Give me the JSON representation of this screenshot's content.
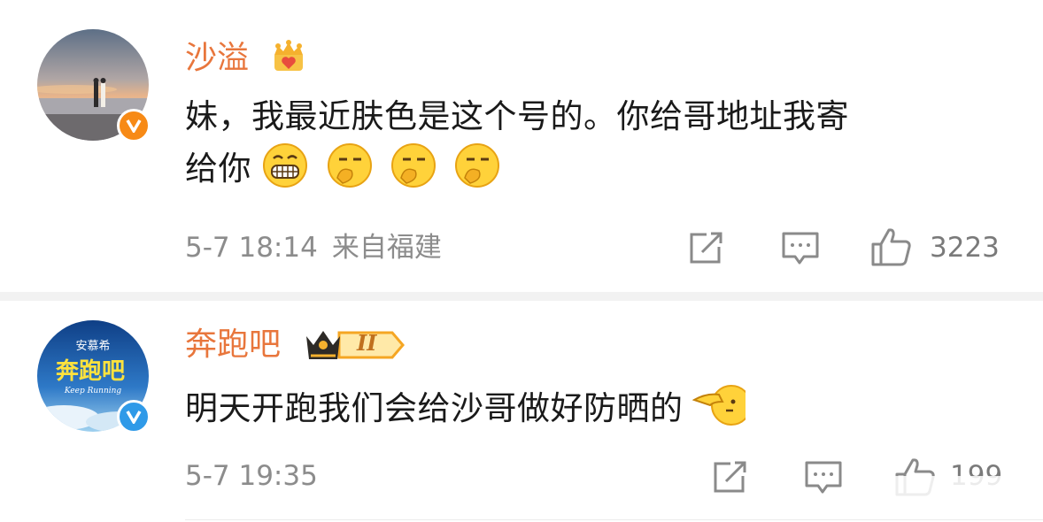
{
  "comments": [
    {
      "username": "沙溢",
      "text_line1": "妹，我最近肤色是这个号的。你给哥地址我寄",
      "text_line2": "给你",
      "time": "5-7 18:14",
      "location": "来自福建",
      "likes": "3223",
      "verify_icon": "orange-verified-v",
      "badge_icon": "gold-crown-heart-badge",
      "emojis": [
        "grin-icon",
        "yawn-icon",
        "yawn-icon",
        "yawn-icon"
      ]
    },
    {
      "username": "奔跑吧",
      "badge_level": "II",
      "text": "明天开跑我们会给沙哥做好防晒的",
      "time": "5-7 19:35",
      "likes": "199",
      "verify_icon": "blue-verified-v",
      "avatar_text_top": "安慕希",
      "avatar_text_main": "奔跑吧",
      "avatar_text_sub": "Keep Running",
      "badge_icon": "crown-level-badge",
      "emojis": [
        "pointing-hand-icon"
      ]
    }
  ],
  "icons": {
    "repost": "repost-icon",
    "comment": "comment-icon",
    "like": "thumb-up-icon"
  },
  "colors": {
    "username": "#e8763c",
    "text": "#1a1a1a",
    "meta": "#8c8c8c",
    "verify_orange": "#f78a16",
    "verify_blue": "#2f9ae8"
  }
}
